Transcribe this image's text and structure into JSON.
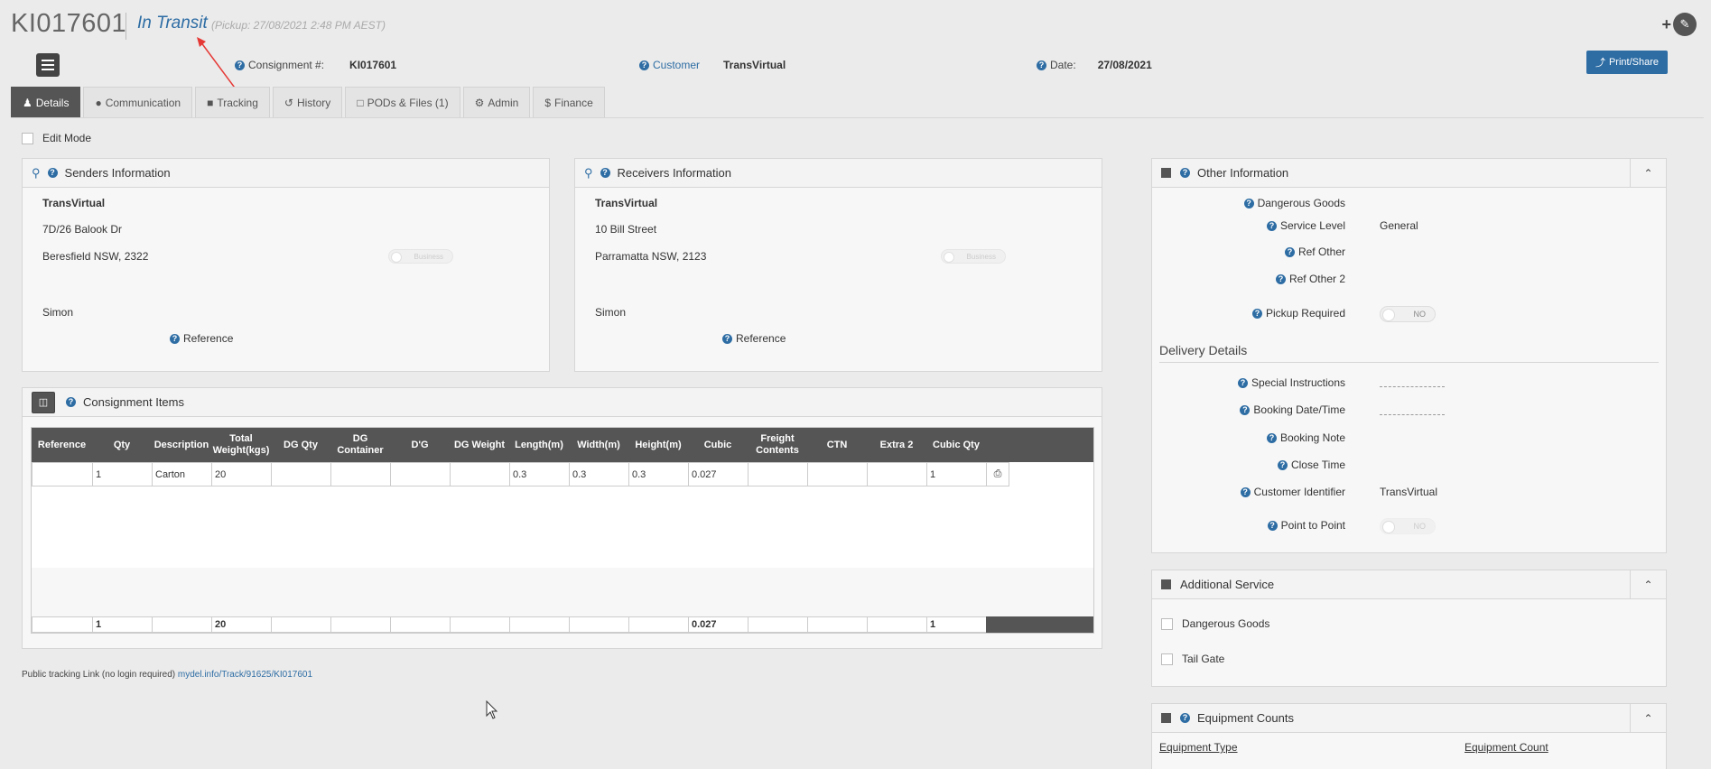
{
  "header": {
    "consignment_id": "KI017601",
    "status": "In Transit",
    "pickup": "(Pickup: 27/08/2021 2:48 PM AEST)"
  },
  "info": {
    "consignment_label": "Consignment #:",
    "consignment_value": "KI017601",
    "customer_label": "Customer",
    "customer_value": "TransVirtual",
    "date_label": "Date:",
    "date_value": "27/08/2021"
  },
  "toolbar": {
    "print_label": "Print/Share"
  },
  "tabs": [
    {
      "label": "Details",
      "icon": "user-icon",
      "active": true
    },
    {
      "label": "Communication",
      "icon": "comment-icon"
    },
    {
      "label": "Tracking",
      "icon": "truck-icon"
    },
    {
      "label": "History",
      "icon": "history-icon"
    },
    {
      "label": "PODs & Files (1)",
      "icon": "file-icon"
    },
    {
      "label": "Admin",
      "icon": "gear-icon"
    },
    {
      "label": "Finance",
      "icon": "dollar-icon"
    }
  ],
  "edit_mode_label": "Edit Mode",
  "senders": {
    "title": "Senders Information",
    "name": "TransVirtual",
    "address1": "7D/26 Balook Dr",
    "address2": "Beresfield NSW, 2322",
    "contact": "Simon",
    "reference_label": "Reference",
    "toggle_label": "Business"
  },
  "receivers": {
    "title": "Receivers Information",
    "name": "TransVirtual",
    "address1": "10 Bill Street",
    "address2": "Parramatta NSW, 2123",
    "contact": "Simon",
    "reference_label": "Reference",
    "toggle_label": "Business"
  },
  "items": {
    "title": "Consignment Items",
    "columns": [
      "Reference",
      "Qty",
      "Description",
      "Total Weight(kgs)",
      "DG Qty",
      "DG Container",
      "D'G",
      "DG Weight",
      "Length(m)",
      "Width(m)",
      "Height(m)",
      "Cubic",
      "Freight Contents",
      "CTN",
      "Extra 2",
      "Cubic Qty"
    ],
    "rows": [
      [
        "",
        "1",
        "Carton",
        "20",
        "",
        "",
        "",
        "",
        "0.3",
        "0.3",
        "0.3",
        "0.027",
        "",
        "",
        "",
        "1"
      ]
    ],
    "totals": [
      "",
      "1",
      "",
      "20",
      "",
      "",
      "",
      "",
      "",
      "",
      "",
      "0.027",
      "",
      "",
      "",
      "1"
    ]
  },
  "public_link": {
    "label": "Public tracking Link (no login required)",
    "url_text": "mydel.info/Track/91625/KI017601"
  },
  "other_info": {
    "title": "Other Information",
    "dangerous_goods_label": "Dangerous Goods",
    "service_level_label": "Service Level",
    "service_level_value": "General",
    "ref_other_label": "Ref Other",
    "ref_other2_label": "Ref Other 2",
    "pickup_required_label": "Pickup Required",
    "pickup_required_value": "NO",
    "delivery_title": "Delivery Details",
    "special_instructions_label": "Special Instructions",
    "booking_datetime_label": "Booking Date/Time",
    "booking_note_label": "Booking Note",
    "close_time_label": "Close Time",
    "customer_identifier_label": "Customer Identifier",
    "customer_identifier_value": "TransVirtual",
    "point_to_point_label": "Point to Point",
    "point_to_point_value": "NO"
  },
  "additional_service": {
    "title": "Additional Service",
    "items": [
      "Dangerous Goods",
      "Tail Gate"
    ]
  },
  "equipment": {
    "title": "Equipment Counts",
    "col1": "Equipment Type",
    "col2": "Equipment Count"
  },
  "colors": {
    "accent": "#2e6da4",
    "dark": "#555555"
  }
}
